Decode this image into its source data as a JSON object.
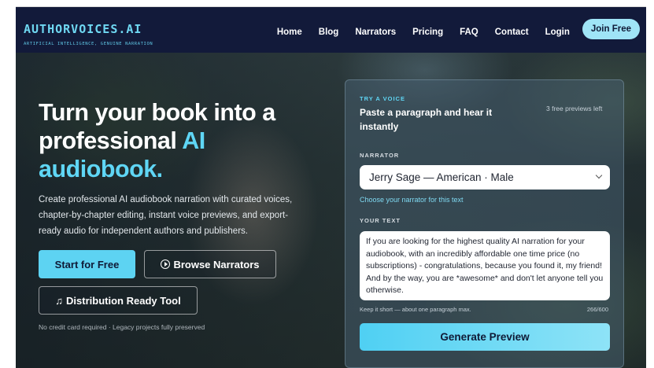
{
  "brand": {
    "name": "AUTHORVOICES.AI",
    "tagline": "ARTIFICIAL INTELLIGENCE, GENUINE NARRATION"
  },
  "nav": {
    "items": [
      {
        "label": "Home"
      },
      {
        "label": "Blog"
      },
      {
        "label": "Narrators"
      },
      {
        "label": "Pricing"
      },
      {
        "label": "FAQ"
      },
      {
        "label": "Contact"
      },
      {
        "label": "Login"
      }
    ],
    "cta": "Join Free"
  },
  "hero": {
    "headline_part1": "Turn your book into a professional ",
    "headline_accent1": "AI",
    "headline_accent2": "audiobook.",
    "subtext": "Create professional AI audiobook narration with curated voices, chapter-by-chapter editing, instant voice previews, and export-ready audio for independent authors and publishers.",
    "primary_button": "Start for Free",
    "browse_button": "Browse Narrators",
    "distribution_button": "Distribution Ready Tool",
    "fineprint": "No credit card required · Legacy projects fully preserved"
  },
  "panel": {
    "eyebrow": "TRY A VOICE",
    "title": "Paste a paragraph and hear it instantly",
    "limit": "3 free previews left",
    "narrator_label": "NARRATOR",
    "narrator_value": "Jerry Sage — American · Male",
    "narrator_hint": "Choose your narrator for this text",
    "text_label": "YOUR TEXT",
    "text_value": "If you are looking for the highest quality AI narration for your audiobook, with an incredibly affordable one time price (no subscriptions) - congratulations, because you found it, my friend! And by the way, you are *awesome* and don't let anyone tell you otherwise.",
    "text_hint": "Keep it short — about one paragraph max.",
    "char_count": "266/600",
    "generate_button": "Generate Preview"
  },
  "colors": {
    "accent": "#5fd6f5",
    "nav_bg": "#121a3a",
    "button_primary": "#5dd3f2"
  },
  "icons": {
    "browse": "play-circle-icon",
    "distribution": "music-note-icon",
    "select": "chevron-down-icon"
  }
}
